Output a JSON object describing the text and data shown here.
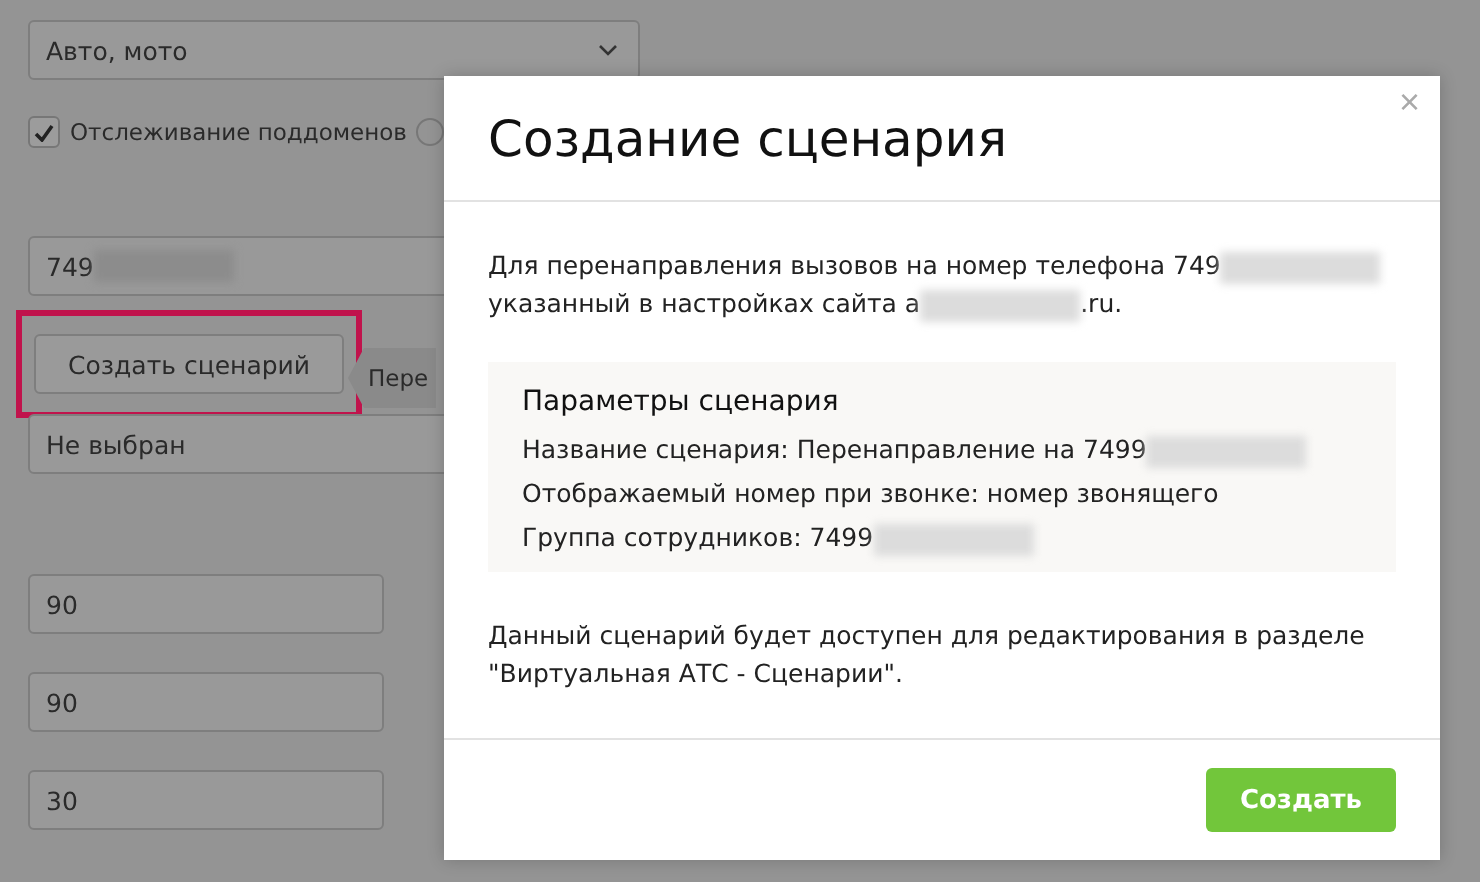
{
  "background_form": {
    "category_select": {
      "value": "Авто, мото"
    },
    "subdomain_tracking": {
      "label": "Отслеживание поддоменов",
      "checked": true
    },
    "phone_field": {
      "value": "749",
      "redacted": true
    },
    "create_button": {
      "label": "Создать сценарий",
      "highlighted": true
    },
    "hint": {
      "text": "Пере"
    },
    "status_select": {
      "value": "Не выбран"
    },
    "number_fields": [
      {
        "value": "90"
      },
      {
        "value": "90"
      },
      {
        "value": "30"
      }
    ]
  },
  "modal": {
    "title": "Создание сценария",
    "close": "×",
    "intro_lines": [
      [
        {
          "kind": "text",
          "text": "Для перенаправления вызовов на номер телефона 749"
        },
        {
          "kind": "redacted"
        }
      ],
      [
        {
          "kind": "text",
          "text": "указанный в настройках сайта a"
        },
        {
          "kind": "redacted"
        },
        {
          "kind": "text",
          "text": ".ru."
        }
      ]
    ],
    "params": {
      "title": "Параметры сценария",
      "rows": [
        [
          {
            "kind": "text",
            "text": "Название сценария: Перенаправление на 7499"
          },
          {
            "kind": "redacted"
          }
        ],
        [
          {
            "kind": "text",
            "text": "Отображаемый номер при звонке: номер звонящего"
          }
        ],
        [
          {
            "kind": "text",
            "text": "Группа сотрудников: 7499"
          },
          {
            "kind": "redacted"
          }
        ]
      ]
    },
    "outro_lines": [
      "Данный сценарий будет доступен для редактирования в разделе",
      "\"Виртуальная АТС - Сценарии\"."
    ],
    "submit_button": "Создать"
  }
}
